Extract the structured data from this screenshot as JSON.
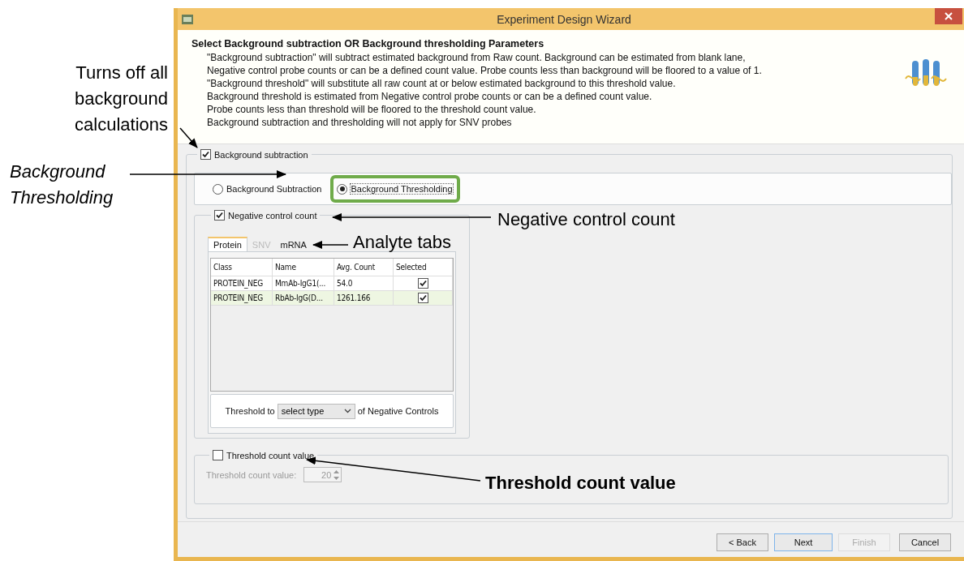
{
  "window": {
    "title": "Experiment Design Wizard"
  },
  "header": {
    "title": "Select Background subtraction OR Background thresholding Parameters",
    "lines": [
      "\"Background subtraction\" will subtract estimated background from Raw count. Background can be estimated from blank lane,",
      "Negative control probe counts or can be a defined count value. Probe counts less than background will be floored to a value of 1.",
      "\"Background threshold\" will substitute all raw count at or below estimated background to this threshold value.",
      "Background threshold is estimated from Negative control probe counts or can be a defined count value.",
      "Probe counts less than threshold will be floored to the threshold count value.",
      "Background subtraction and thresholding will not apply for SNV probes"
    ]
  },
  "background_subtraction": {
    "label": "Background subtraction",
    "checked": true,
    "options": [
      {
        "label": "Background Subtraction",
        "selected": false,
        "highlighted": false
      },
      {
        "label": "Background Thresholding",
        "selected": true,
        "highlighted": true
      }
    ]
  },
  "negative_control": {
    "label": "Negative control count",
    "checked": true,
    "tabs": [
      {
        "label": "Protein",
        "selected": true,
        "disabled": false
      },
      {
        "label": "SNV",
        "selected": false,
        "disabled": true
      },
      {
        "label": "mRNA",
        "selected": false,
        "disabled": false
      }
    ],
    "table": {
      "columns": [
        "Class",
        "Name",
        "Avg. Count",
        "Selected"
      ],
      "rows": [
        {
          "cells": [
            "PROTEIN_NEG",
            "MmAb-IgG1(...",
            "54.0"
          ],
          "checked": true,
          "selected": false
        },
        {
          "cells": [
            "PROTEIN_NEG",
            "RbAb-IgG(D...",
            "1261.166"
          ],
          "checked": true,
          "selected": true
        }
      ]
    },
    "threshold_to": {
      "label": "Threshold to",
      "select": "select type",
      "suffix": "of Negative Controls"
    }
  },
  "threshold_count": {
    "label": "Threshold count value",
    "checked": false,
    "field_label": "Threshold count value:",
    "value": "20"
  },
  "buttons": [
    {
      "label": "< Back",
      "disabled": false,
      "default": false
    },
    {
      "label": "Next",
      "disabled": false,
      "default": true
    },
    {
      "label": "Finish",
      "disabled": true,
      "default": false
    },
    {
      "label": "Cancel",
      "disabled": false,
      "default": false
    }
  ],
  "annotations": [
    {
      "text": "Turns off all background calculations",
      "kind": "plain"
    },
    {
      "text": "Background Thresholding",
      "kind": "italic"
    },
    {
      "text": "Negative control count",
      "kind": "plain"
    },
    {
      "text": "Analyte tabs",
      "kind": "plain"
    },
    {
      "text": "Threshold count value",
      "kind": "bold"
    }
  ]
}
